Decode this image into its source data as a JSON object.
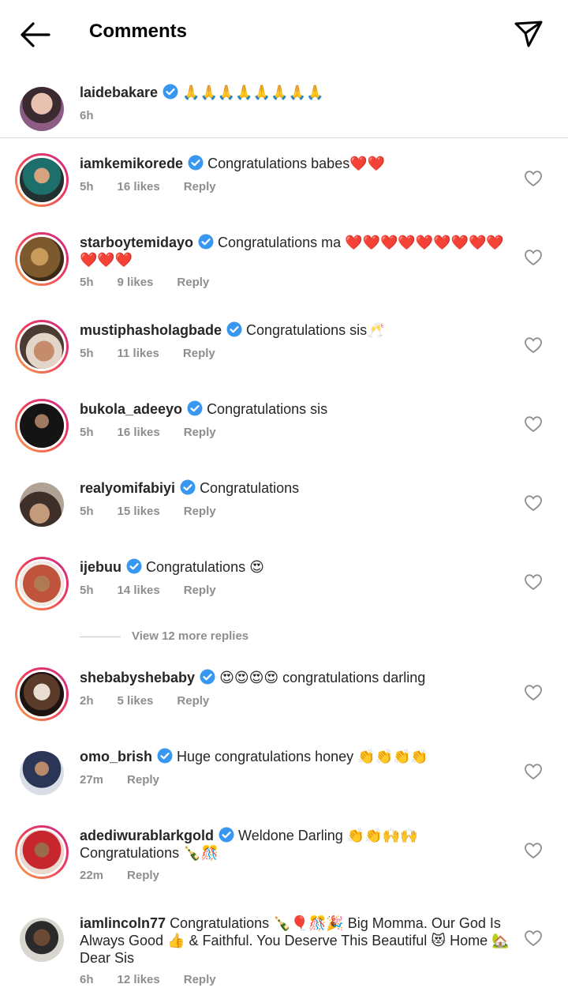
{
  "header": {
    "title": "Comments"
  },
  "caption": {
    "username": "laidebakare",
    "text": "🙏🙏🙏🙏🙏🙏🙏🙏",
    "time": "6h"
  },
  "comments": [
    {
      "username": "iamkemikorede",
      "text": "Congratulations babes❤️❤️",
      "time": "5h",
      "likes": "16 likes",
      "reply": "Reply"
    },
    {
      "username": "starboytemidayo",
      "text": "Congratulations ma ❤️❤️❤️❤️❤️❤️❤️❤️❤️❤️❤️❤️",
      "time": "5h",
      "likes": "9 likes",
      "reply": "Reply"
    },
    {
      "username": "mustiphasholagbade",
      "text": "Congratulations sis🥂",
      "time": "5h",
      "likes": "11 likes",
      "reply": "Reply"
    },
    {
      "username": "bukola_adeeyo",
      "text": "Congratulations sis",
      "time": "5h",
      "likes": "16 likes",
      "reply": "Reply"
    },
    {
      "username": "realyomifabiyi",
      "text": "Congratulations",
      "time": "5h",
      "likes": "15 likes",
      "reply": "Reply"
    },
    {
      "username": "ijebuu",
      "text": "Congratulations 😍",
      "time": "5h",
      "likes": "14 likes",
      "reply": "Reply"
    },
    {
      "username": "shebabyshebaby",
      "text": "😍😍😍😍 congratulations darling",
      "time": "2h",
      "likes": "5 likes",
      "reply": "Reply"
    },
    {
      "username": "omo_brish",
      "text": "Huge congratulations honey 👏👏👏👏",
      "time": "27m",
      "likes": "",
      "reply": "Reply"
    },
    {
      "username": "adediwurablarkgold",
      "text": "Weldone Darling 👏👏🙌🙌 Congratulations 🍾🎊",
      "time": "22m",
      "likes": "",
      "reply": "Reply"
    },
    {
      "username": "iamlincoln77",
      "text": "Congratulations 🍾🎈🎊🎉 Big Momma. Our God Is Always Good 👍 & Faithful. You Deserve This Beautiful 😻 Home 🏡 Dear Sis",
      "time": "6h",
      "likes": "12 likes",
      "reply": "Reply"
    }
  ],
  "view_more": "View 12 more replies",
  "icons": {
    "back": "arrow-left-icon",
    "send": "paper-plane-icon",
    "verified": "verified-badge-icon",
    "like": "heart-outline-icon"
  },
  "colors": {
    "verified": "#3897f0",
    "meta": "#8e8e8e",
    "divider": "#dbdbdb"
  }
}
